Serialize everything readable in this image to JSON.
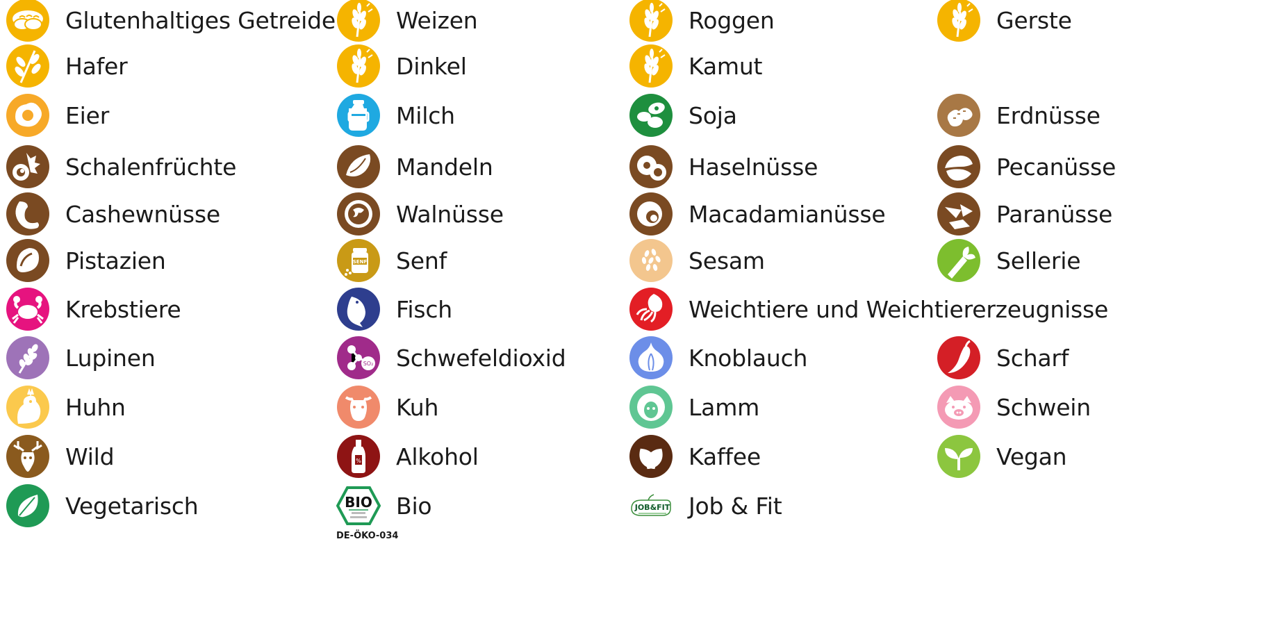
{
  "items": [
    {
      "label": "Glutenhaltiges Getreide",
      "icon": "bread-icon",
      "color": "#F5B400"
    },
    {
      "label": "Weizen",
      "icon": "wheat-icon",
      "color": "#F5B400"
    },
    {
      "label": "Roggen",
      "icon": "wheat-icon",
      "color": "#F5B400"
    },
    {
      "label": "Gerste",
      "icon": "wheat-icon",
      "color": "#F5B400"
    },
    {
      "label": "Hafer",
      "icon": "oat-icon",
      "color": "#F5B400"
    },
    {
      "label": "Dinkel",
      "icon": "wheat-icon",
      "color": "#F5B400"
    },
    {
      "label": "Kamut",
      "icon": "wheat-icon",
      "color": "#F5B400"
    },
    {
      "label": "Eier",
      "icon": "egg-icon",
      "color": "#F7A928"
    },
    {
      "label": "Milch",
      "icon": "milk-can-icon",
      "color": "#1FA9E1"
    },
    {
      "label": "Soja",
      "icon": "soy-icon",
      "color": "#1E8F3E"
    },
    {
      "label": "Erdnüsse",
      "icon": "peanut-icon",
      "color": "#A87845"
    },
    {
      "label": "Schalenfrüchte",
      "icon": "nuts-icon",
      "color": "#7A4A22"
    },
    {
      "label": "Mandeln",
      "icon": "almond-icon",
      "color": "#7A4A22"
    },
    {
      "label": "Haselnüsse",
      "icon": "hazelnut-icon",
      "color": "#7A4A22"
    },
    {
      "label": "Pecanüsse",
      "icon": "pecan-icon",
      "color": "#7A4A22"
    },
    {
      "label": "Cashewnüsse",
      "icon": "cashew-icon",
      "color": "#7A4A22"
    },
    {
      "label": "Walnüsse",
      "icon": "walnut-icon",
      "color": "#7A4A22"
    },
    {
      "label": "Macadamianüsse",
      "icon": "macadamia-icon",
      "color": "#7A4A22"
    },
    {
      "label": "Paranüsse",
      "icon": "brazil-nut-icon",
      "color": "#7A4A22"
    },
    {
      "label": "Pistazien",
      "icon": "pistachio-icon",
      "color": "#7A4A22"
    },
    {
      "label": "Senf",
      "icon": "mustard-icon",
      "color": "#C99A16"
    },
    {
      "label": "Sesam",
      "icon": "sesame-icon",
      "color": "#F3C68E"
    },
    {
      "label": "Sellerie",
      "icon": "celery-icon",
      "color": "#7DBE2E"
    },
    {
      "label": "Krebstiere",
      "icon": "crab-icon",
      "color": "#E6137F"
    },
    {
      "label": "Fisch",
      "icon": "fish-icon",
      "color": "#2E3E8E"
    },
    {
      "label": "Weichtiere und Weichtiererzeugnisse",
      "icon": "squid-icon",
      "color": "#E31E25"
    },
    {
      "label": "Lupinen",
      "icon": "lupin-icon",
      "color": "#9E73B8"
    },
    {
      "label": "Schwefeldioxid",
      "icon": "molecule-icon",
      "color": "#A02B8A"
    },
    {
      "label": "Knoblauch",
      "icon": "garlic-icon",
      "color": "#6C8EE8"
    },
    {
      "label": "Scharf",
      "icon": "chili-icon",
      "color": "#D41F26"
    },
    {
      "label": "Huhn",
      "icon": "chicken-icon",
      "color": "#FBC94D"
    },
    {
      "label": "Kuh",
      "icon": "cow-icon",
      "color": "#F08A6B"
    },
    {
      "label": "Lamm",
      "icon": "sheep-icon",
      "color": "#5FC693"
    },
    {
      "label": "Schwein",
      "icon": "pig-icon",
      "color": "#F49AB4"
    },
    {
      "label": "Wild",
      "icon": "deer-icon",
      "color": "#8A5A1E"
    },
    {
      "label": "Alkohol",
      "icon": "bottle-icon",
      "color": "#8E1414"
    },
    {
      "label": "Kaffee",
      "icon": "coffee-bean-icon",
      "color": "#5A2B12"
    },
    {
      "label": "Vegan",
      "icon": "sprout-icon",
      "color": "#8CC63F"
    },
    {
      "label": "Vegetarisch",
      "icon": "leaf-icon",
      "color": "#1F9A55"
    },
    {
      "label": "Bio",
      "icon": "bio-seal-icon",
      "color": "#1F9A55",
      "code": "DE-ÖKO-034",
      "seal_text": "BIO"
    },
    {
      "label": "Job & Fit",
      "icon": "job-fit-logo-icon",
      "color": "#3A8E3A",
      "logo_text": "JOB&FIT"
    }
  ]
}
